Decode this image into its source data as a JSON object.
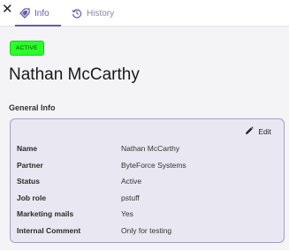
{
  "tabs": [
    {
      "label": "Info",
      "icon": "tag-icon",
      "active": true
    },
    {
      "label": "History",
      "icon": "history-icon",
      "active": false
    }
  ],
  "close_glyph": "✕",
  "status_badge": "ACTIVE",
  "page_title": "Nathan McCarthy",
  "section_title": "General Info",
  "edit_label": "Edit",
  "fields": [
    {
      "label": "Name",
      "value": "Nathan McCarthy"
    },
    {
      "label": "Partner",
      "value": "ByteForce Systems"
    },
    {
      "label": "Status",
      "value": "Active"
    },
    {
      "label": "Job role",
      "value": "pstuff"
    },
    {
      "label": "Marketing mails",
      "value": "Yes"
    },
    {
      "label": "Internal Comment",
      "value": "Only for testing"
    }
  ],
  "colors": {
    "accent": "#6a5aa8",
    "badge_bg": "#2bff2b",
    "card_bg": "#e9e7f1",
    "card_border": "#a79dc8"
  }
}
